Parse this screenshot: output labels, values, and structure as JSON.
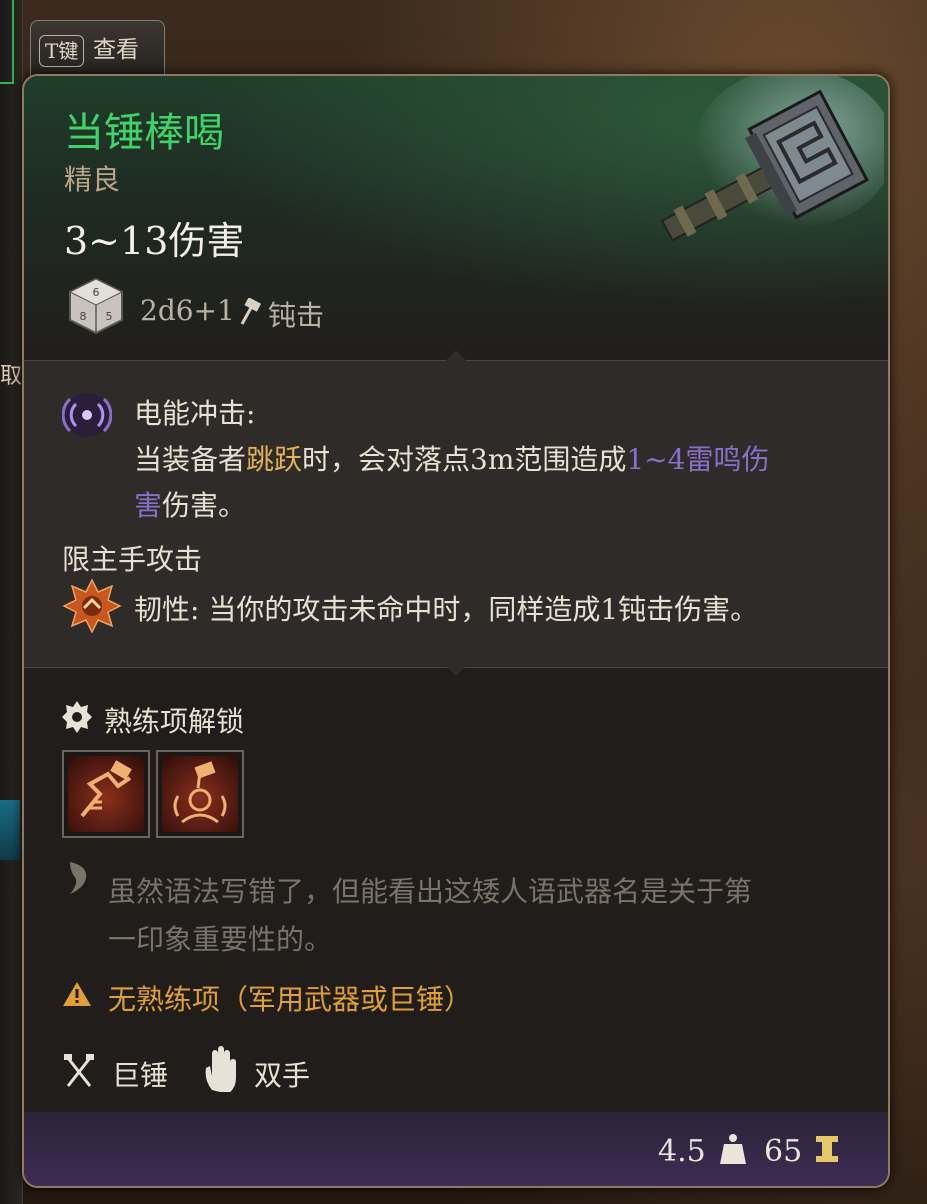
{
  "side_panel": {
    "char": "取"
  },
  "inspect_tab": {
    "key": "T键",
    "label": "查看"
  },
  "item": {
    "name": "当锤棒喝",
    "rarity": "精良",
    "damage": "3~13伤害",
    "dice": "2d6+1",
    "damage_type": "钝击",
    "name_color": "#3fd36a"
  },
  "effects": {
    "electric": {
      "title": "电能冲击:",
      "line1_pre": "当装备者",
      "line1_hl": "跳跃",
      "line1_mid": "时，会对落点3m范围造成",
      "line1_purple": "1~4雷鸣伤",
      "line2_purple": "害",
      "line2_post": "伤害。"
    },
    "main_hand": "限主手攻击",
    "tenacity": {
      "title": "韧性:",
      "text": " 当你的攻击未命中时，同样造成1钝击伤害。"
    }
  },
  "proficiency": {
    "label": "熟练项解锁",
    "icons": [
      "rush-attack-icon",
      "tenacity-shout-icon"
    ]
  },
  "flavor": {
    "line1": "虽然语法写错了，但能看出这矮人语武器名是关于第",
    "line2": "一印象重要性的。"
  },
  "warning": "无熟练项（军用武器或巨锤）",
  "properties": {
    "weapon_type": "巨锤",
    "handedness": "双手"
  },
  "footer": {
    "weight": "4.5",
    "gold": "65"
  }
}
